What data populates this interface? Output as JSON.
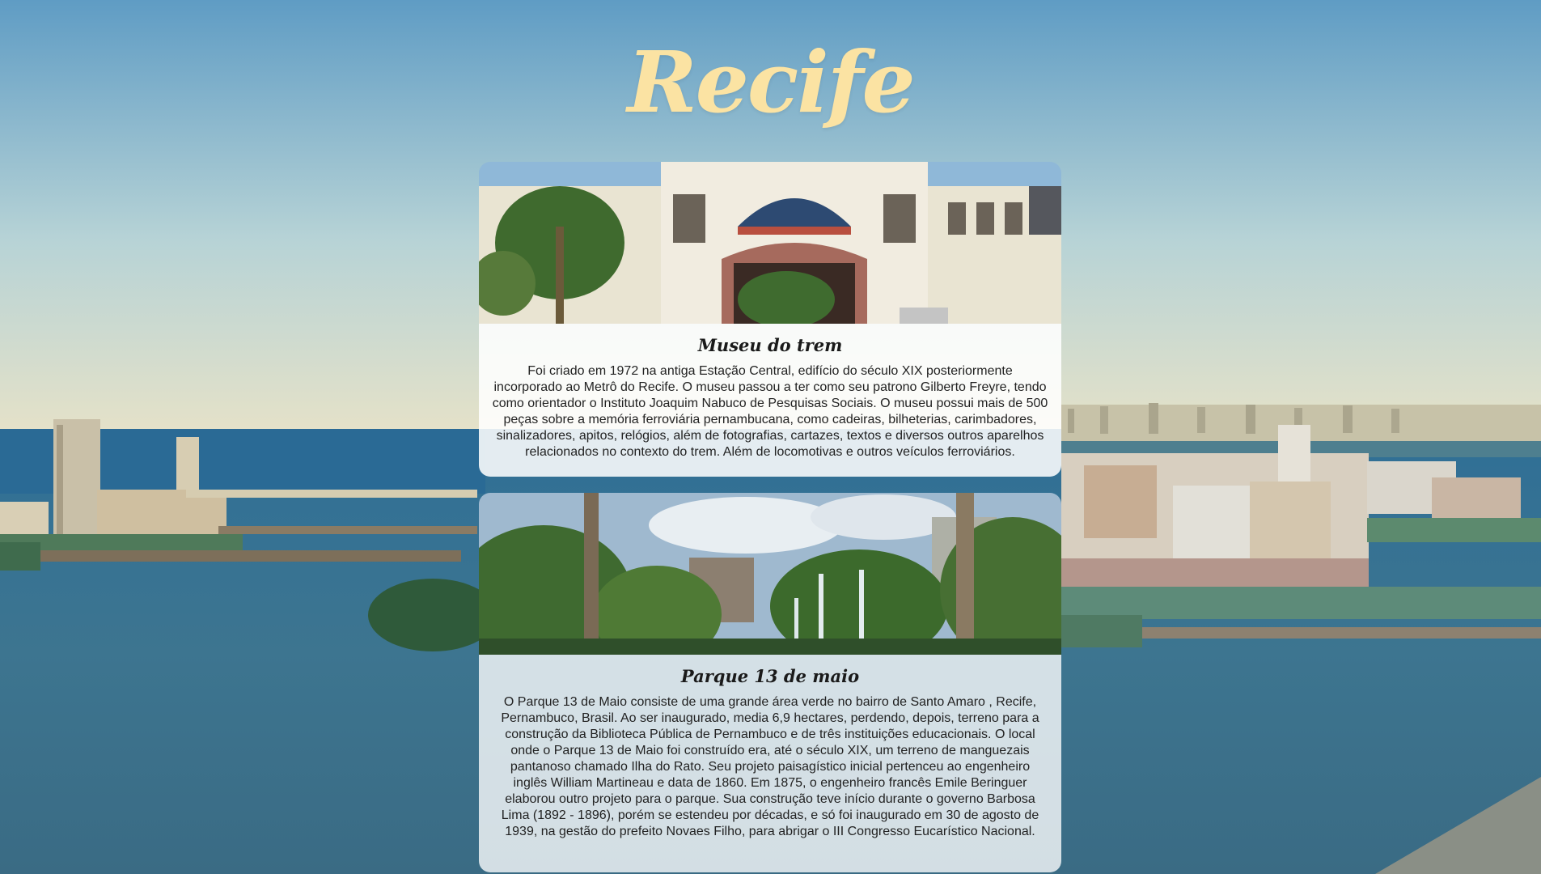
{
  "page": {
    "title": "Recife"
  },
  "colors": {
    "title": "#fbe3a3",
    "card_bg": "#ffffff",
    "text": "#222222",
    "sea": "#3b6f8c",
    "sky": "#9cc4d3"
  },
  "cards": [
    {
      "title": "Museu do trem",
      "photo": "museum-building-photo",
      "text": "Foi criado em 1972 na antiga Estação Central, edifício do século XIX posteriormente incorporado ao Metrô do Recife. O museu passou a ter como seu patrono Gilberto Freyre, tendo como orientador o Instituto Joaquim Nabuco de Pesquisas Sociais. O museu possui mais de 500 peças sobre a memória ferroviária pernambucana, como cadeiras, bilheterias, carimbadores, sinalizadores, apitos, relógios, além de fotografias, cartazes, textos e diversos outros aparelhos relacionados no contexto do trem. Além de locomotivas e outros veículos ferroviários."
    },
    {
      "title": "Parque 13 de maio",
      "photo": "park-fountain-photo",
      "text": "O Parque 13 de Maio consiste de uma grande área verde no bairro de Santo Amaro , Recife, Pernambuco, Brasil. Ao ser inaugurado, media 6,9 hectares, perdendo, depois, terreno para a construção da Biblioteca Pública de Pernambuco e de três instituições educacionais. O local onde o Parque 13 de Maio foi construído era, até o século XIX, um terreno de manguezais pantanoso chamado Ilha do Rato. Seu projeto paisagístico inicial pertenceu ao engenheiro inglês William Martineau e data de 1860. Em 1875, o engenheiro francês Emile Beringuer elaborou outro projeto para o parque. Sua construção teve início durante o governo Barbosa Lima (1892 - 1896), porém se estendeu por décadas, e só foi inaugurado em 30 de agosto de 1939, na gestão do prefeito Novaes Filho, para abrigar o III Congresso Eucarístico Nacional."
    }
  ]
}
